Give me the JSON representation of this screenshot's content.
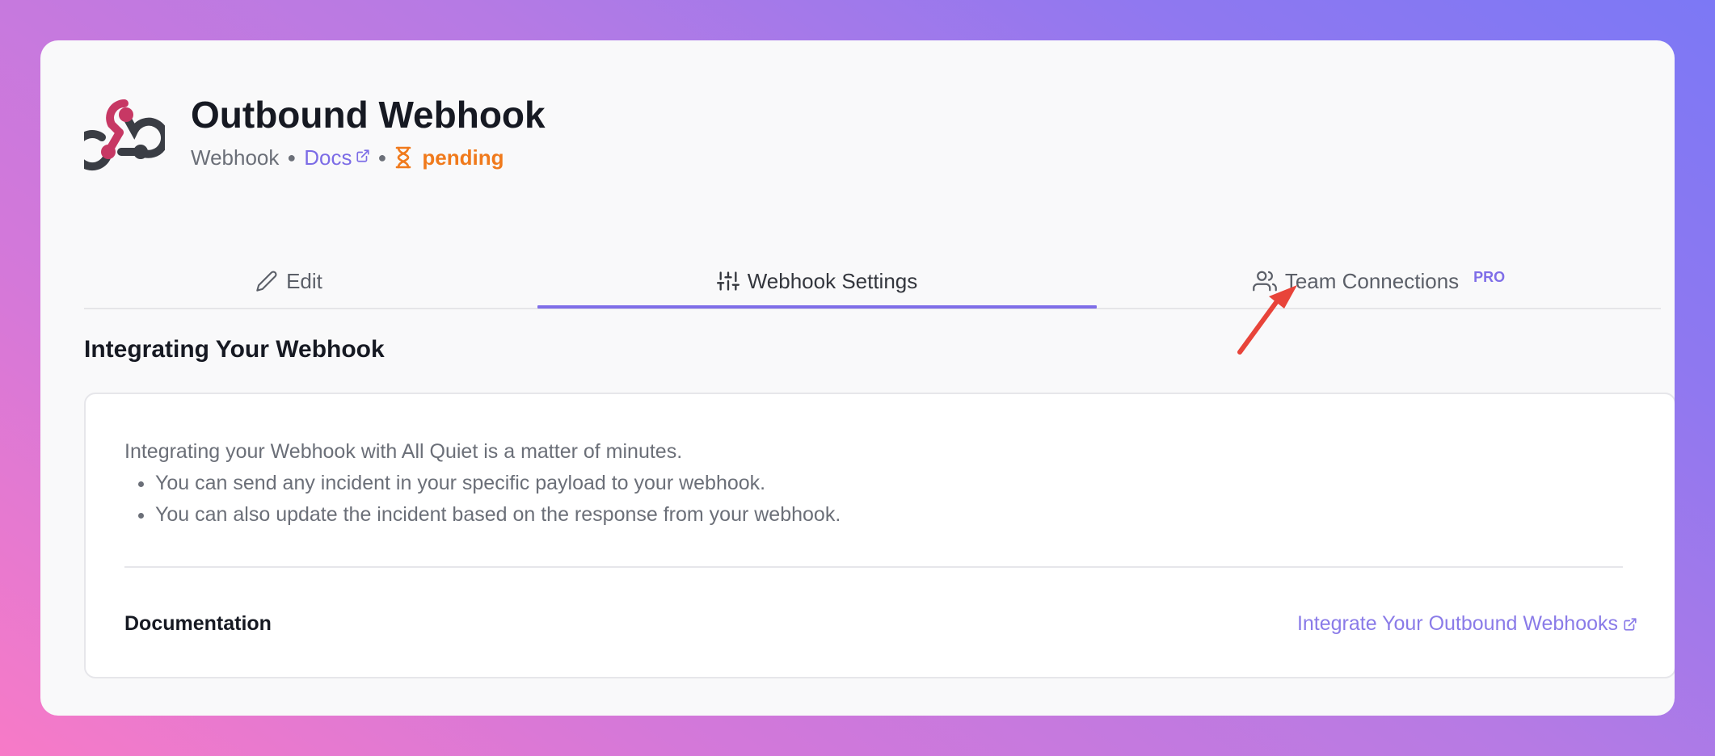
{
  "app": {
    "title": "Outbound Webhook",
    "type": "Webhook",
    "docs_label": "Docs",
    "status": "pending"
  },
  "tabs": [
    {
      "label": "Edit",
      "icon": "pencil-icon",
      "active": false
    },
    {
      "label": "Webhook Settings",
      "icon": "sliders-icon",
      "active": true
    },
    {
      "label": "Team Connections",
      "icon": "users-icon",
      "active": false,
      "badge": "PRO"
    }
  ],
  "section": {
    "title": "Integrating Your Webhook",
    "intro": "Integrating your Webhook with All Quiet is a matter of minutes.",
    "bullets": [
      "You can send any incident in your specific payload to your webhook.",
      "You can also update the incident based on the response from your webhook."
    ],
    "doc_label": "Documentation",
    "doc_link": "Integrate Your Outbound Webhooks"
  },
  "colors": {
    "accent": "#7f6ee8",
    "status_pending": "#f07a1c",
    "annotation_arrow": "#e8443a"
  }
}
